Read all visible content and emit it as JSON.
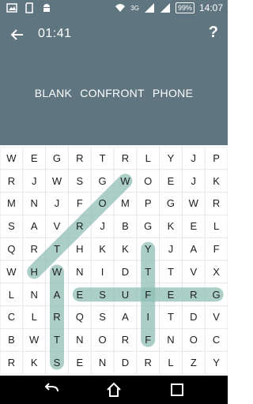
{
  "status_bar": {
    "time": "14:07",
    "battery": "99%",
    "network": "3G",
    "left_icons": [
      "image-icon",
      "sd-card-icon",
      "android-icon"
    ]
  },
  "header": {
    "timer": "01:41",
    "help_label": "?",
    "words": [
      "BLANK",
      "CONFRONT",
      "PHONE"
    ]
  },
  "grid": {
    "rows": [
      [
        "W",
        "E",
        "G",
        "R",
        "T",
        "R",
        "L",
        "Y",
        "J",
        "P"
      ],
      [
        "R",
        "J",
        "W",
        "S",
        "G",
        "W",
        "O",
        "E",
        "J",
        "K"
      ],
      [
        "M",
        "N",
        "J",
        "F",
        "O",
        "M",
        "P",
        "G",
        "W",
        "R"
      ],
      [
        "S",
        "A",
        "V",
        "R",
        "J",
        "B",
        "G",
        "K",
        "E",
        "L"
      ],
      [
        "Q",
        "R",
        "T",
        "H",
        "K",
        "K",
        "Y",
        "J",
        "A",
        "F"
      ],
      [
        "W",
        "H",
        "W",
        "N",
        "I",
        "D",
        "T",
        "T",
        "V",
        "X"
      ],
      [
        "L",
        "N",
        "A",
        "E",
        "S",
        "U",
        "F",
        "E",
        "R",
        "G"
      ],
      [
        "C",
        "L",
        "R",
        "Q",
        "S",
        "A",
        "I",
        "T",
        "D",
        "V"
      ],
      [
        "B",
        "W",
        "T",
        "N",
        "O",
        "R",
        "F",
        "N",
        "O",
        "C"
      ],
      [
        "R",
        "K",
        "S",
        "E",
        "N",
        "D",
        "R",
        "L",
        "Z",
        "Y"
      ]
    ],
    "highlighted_words": [
      {
        "from": [
          1,
          5
        ],
        "to": [
          5,
          1
        ]
      },
      {
        "from": [
          5,
          2
        ],
        "to": [
          9,
          2
        ]
      },
      {
        "from": [
          6,
          3
        ],
        "to": [
          6,
          9
        ]
      },
      {
        "from": [
          4,
          6
        ],
        "to": [
          8,
          6
        ]
      }
    ],
    "highlight_color": "#8fbfb4"
  },
  "colors": {
    "header_bg": "#5f7580",
    "grid_line": "#e6e6e6",
    "navbar_bg": "#000000"
  },
  "nav": {
    "icons": [
      "back-arrow-icon",
      "home-icon",
      "recent-apps-icon"
    ]
  }
}
